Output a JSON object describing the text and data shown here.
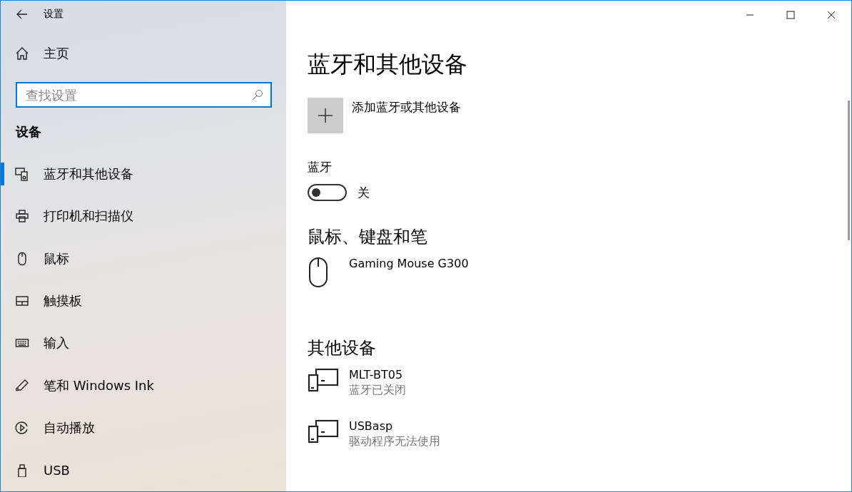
{
  "window": {
    "title": "设置"
  },
  "sidebar": {
    "home": "主页",
    "search": {
      "placeholder": "查找设置"
    },
    "heading": "设备",
    "items": [
      {
        "label": "蓝牙和其他设备",
        "selected": true
      },
      {
        "label": "打印机和扫描仪",
        "selected": false
      },
      {
        "label": "鼠标",
        "selected": false
      },
      {
        "label": "触摸板",
        "selected": false
      },
      {
        "label": "输入",
        "selected": false
      },
      {
        "label": "笔和 Windows Ink",
        "selected": false
      },
      {
        "label": "自动播放",
        "selected": false
      },
      {
        "label": "USB",
        "selected": false
      }
    ]
  },
  "content": {
    "title": "蓝牙和其他设备",
    "add_button": "添加蓝牙或其他设备",
    "bluetooth": {
      "label": "蓝牙",
      "on": false,
      "state": "关"
    },
    "sections": [
      {
        "heading": "鼠标、键盘和笔",
        "kind": "input",
        "devices": [
          {
            "name": "Gaming Mouse G300"
          }
        ]
      },
      {
        "heading": "其他设备",
        "kind": "other",
        "devices": [
          {
            "name": "MLT-BT05",
            "status": "蓝牙已关闭"
          },
          {
            "name": "USBasp",
            "status": "驱动程序无法使用"
          }
        ]
      }
    ]
  }
}
